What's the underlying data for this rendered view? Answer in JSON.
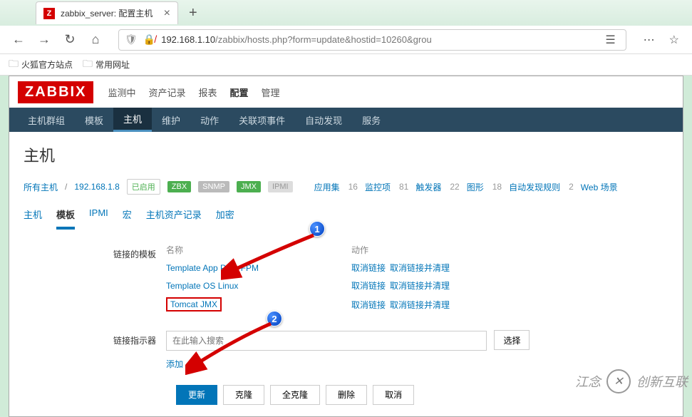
{
  "browser": {
    "tab_title": "zabbix_server: 配置主机",
    "tab_favicon": "Z",
    "url_prefix": "192.168.1.10",
    "url_path": "/zabbix/hosts.php?form=update&hostid=10260&grou",
    "bookmarks": [
      "火狐官方站点",
      "常用网址"
    ]
  },
  "zabbix": {
    "logo": "ZABBIX",
    "top_menu": [
      "监测中",
      "资产记录",
      "报表",
      "配置",
      "管理"
    ],
    "top_menu_active": 3,
    "sub_nav": [
      "主机群组",
      "模板",
      "主机",
      "维护",
      "动作",
      "关联项事件",
      "自动发现",
      "服务"
    ],
    "sub_nav_active": 2,
    "page_title": "主机",
    "breadcrumb": {
      "all_hosts": "所有主机",
      "host": "192.168.1.8",
      "enabled": "已启用",
      "zbx": "ZBX",
      "snmp": "SNMP",
      "jmx": "JMX",
      "ipmi": "IPMI",
      "stats": [
        {
          "label": "应用集",
          "count": "16"
        },
        {
          "label": "监控项",
          "count": "81"
        },
        {
          "label": "触发器",
          "count": "22"
        },
        {
          "label": "图形",
          "count": "18"
        },
        {
          "label": "自动发现规则",
          "count": "2"
        },
        {
          "label": "Web 场景",
          "count": ""
        }
      ]
    },
    "tabs": [
      "主机",
      "模板",
      "IPMI",
      "宏",
      "主机资产记录",
      "加密"
    ],
    "tabs_active": 1,
    "linked_templates": {
      "label": "链接的模板",
      "col_name": "名称",
      "col_action": "动作",
      "rows": [
        {
          "name": "Template App PHP-FPM",
          "unlink": "取消链接",
          "unlink_clear": "取消链接并清理"
        },
        {
          "name": "Template OS Linux",
          "unlink": "取消链接",
          "unlink_clear": "取消链接并清理"
        },
        {
          "name": "Tomcat JMX",
          "unlink": "取消链接",
          "unlink_clear": "取消链接并清理"
        }
      ]
    },
    "link_indicator": {
      "label": "链接指示器",
      "placeholder": "在此输入搜索",
      "select_btn": "选择",
      "add_link": "添加"
    },
    "buttons": {
      "update": "更新",
      "clone": "克隆",
      "full_clone": "全克隆",
      "delete": "删除",
      "cancel": "取消"
    }
  },
  "watermark": {
    "text1": "江念",
    "text2": "创新互联"
  }
}
